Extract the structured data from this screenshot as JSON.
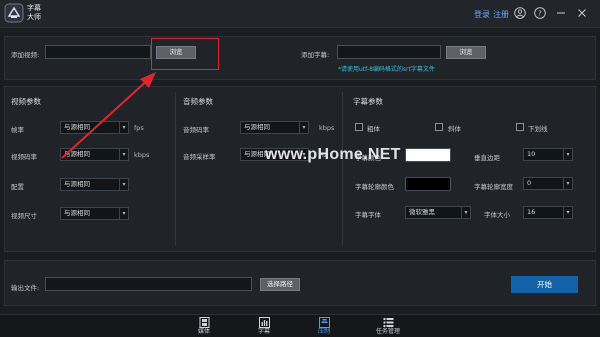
{
  "app": {
    "name": "字幕大师"
  },
  "header": {
    "login": "登录",
    "register": "注册"
  },
  "add_video": {
    "label": "添加视频:",
    "value": "",
    "browse": "浏览"
  },
  "add_subtitle": {
    "label": "添加字幕:",
    "value": "",
    "browse": "浏览",
    "hint": "*请使用utf-8编码格式的srt字幕文件"
  },
  "video_params": {
    "title": "视频参数",
    "rows": [
      {
        "label": "帧率",
        "value": "与源相同",
        "unit": "fps"
      },
      {
        "label": "视频码率",
        "value": "与源相同",
        "unit": "kbps"
      },
      {
        "label": "配置",
        "value": "与源相同",
        "unit": ""
      },
      {
        "label": "视频尺寸",
        "value": "与源相同",
        "unit": ""
      }
    ]
  },
  "audio_params": {
    "title": "音频参数",
    "rows": [
      {
        "label": "音频码率",
        "value": "与源相同",
        "unit": "kbps"
      },
      {
        "label": "音频采样率",
        "value": "与源相同",
        "unit": "Hz"
      }
    ]
  },
  "subtitle_params": {
    "title": "字幕参数",
    "bold": "粗体",
    "italic": "斜体",
    "underline": "下划线",
    "font_color_label": "字幕颜色",
    "font_color": "#ffffff",
    "margin_label": "垂直边距",
    "margin_value": "10",
    "outline_color_label": "字幕轮廓颜色",
    "outline_color": "#000000",
    "outline_width_label": "字幕轮廓宽度",
    "outline_width_value": "0",
    "font_label": "字幕字体",
    "font_value": "微软雅黑",
    "size_label": "字体大小",
    "size_value": "16"
  },
  "output": {
    "label": "输出文件:",
    "value": "",
    "choose": "选择路径",
    "start": "开始"
  },
  "tabs": [
    {
      "label": "媒体",
      "icon": "film-icon",
      "active": false
    },
    {
      "label": "字幕",
      "icon": "chart-icon",
      "active": false
    },
    {
      "label": "压制",
      "icon": "compress-icon",
      "active": true
    },
    {
      "label": "任务管理",
      "icon": "list-icon",
      "active": false
    }
  ],
  "watermark": "www.pHome.NET",
  "colors": {
    "accent": "#1463a8",
    "highlight": "#e0262c",
    "hint": "#37c0dc",
    "active_tab": "#3fa2ff"
  }
}
